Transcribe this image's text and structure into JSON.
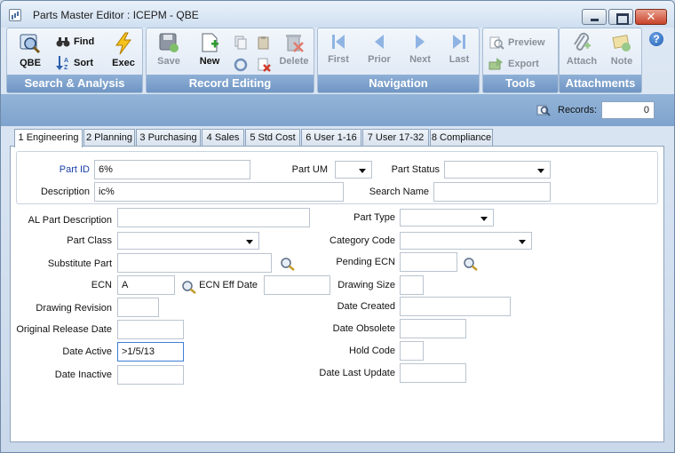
{
  "window": {
    "title": "Parts Master Editor  : ICEPM - QBE",
    "close_glyph": "✕"
  },
  "ribbon": {
    "search": {
      "label": "Search & Analysis",
      "qbe": "QBE",
      "find": "Find",
      "sort": "Sort",
      "exec": "Exec"
    },
    "record": {
      "label": "Record Editing",
      "save": "Save",
      "new": "New",
      "delete": "Delete"
    },
    "navigation": {
      "label": "Navigation",
      "first": "First",
      "prior": "Prior",
      "next": "Next",
      "last": "Last"
    },
    "tools": {
      "label": "Tools",
      "preview": "Preview",
      "export": "Export"
    },
    "attachments": {
      "label": "Attachments",
      "attach": "Attach",
      "note": "Note"
    },
    "help_glyph": "?"
  },
  "records": {
    "label": "Records:",
    "value": "0"
  },
  "tabs": [
    {
      "label": "1 Engineering",
      "active": true
    },
    {
      "label": "2 Planning"
    },
    {
      "label": "3 Purchasing"
    },
    {
      "label": "4 Sales"
    },
    {
      "label": "5 Std Cost"
    },
    {
      "label": "6 User 1-16"
    },
    {
      "label": "7 User 17-32"
    },
    {
      "label": "8 Compliance"
    }
  ],
  "form": {
    "part_id": {
      "label": "Part ID",
      "value": "6%"
    },
    "part_um": {
      "label": "Part UM",
      "value": ""
    },
    "part_status": {
      "label": "Part Status",
      "value": ""
    },
    "description": {
      "label": "Description",
      "value": "ic%"
    },
    "search_name": {
      "label": "Search Name",
      "value": ""
    },
    "al_part_description": {
      "label": "AL Part Description",
      "value": ""
    },
    "part_type": {
      "label": "Part Type",
      "value": ""
    },
    "part_class": {
      "label": "Part Class",
      "value": ""
    },
    "category_code": {
      "label": "Category Code",
      "value": ""
    },
    "substitute_part": {
      "label": "Substitute Part",
      "value": ""
    },
    "pending_ecn": {
      "label": "Pending ECN",
      "value": ""
    },
    "ecn": {
      "label": "ECN",
      "value": "A"
    },
    "ecn_eff_date": {
      "label": "ECN Eff Date",
      "value": ""
    },
    "drawing_size": {
      "label": "Drawing Size",
      "value": ""
    },
    "drawing_revision": {
      "label": "Drawing Revision",
      "value": ""
    },
    "date_created": {
      "label": "Date Created",
      "value": ""
    },
    "original_release_date": {
      "label": "Original Release Date",
      "value": ""
    },
    "date_obsolete": {
      "label": "Date Obsolete",
      "value": ""
    },
    "date_active": {
      "label": "Date Active",
      "value": ">1/5/13"
    },
    "hold_code": {
      "label": "Hold Code",
      "value": ""
    },
    "date_inactive": {
      "label": "Date Inactive",
      "value": ""
    },
    "date_last_update": {
      "label": "Date Last Update",
      "value": ""
    }
  },
  "colors": {
    "accent": "#7ea3cd",
    "label_blue": "#1b3fa8",
    "focus": "#3d7fd6"
  }
}
